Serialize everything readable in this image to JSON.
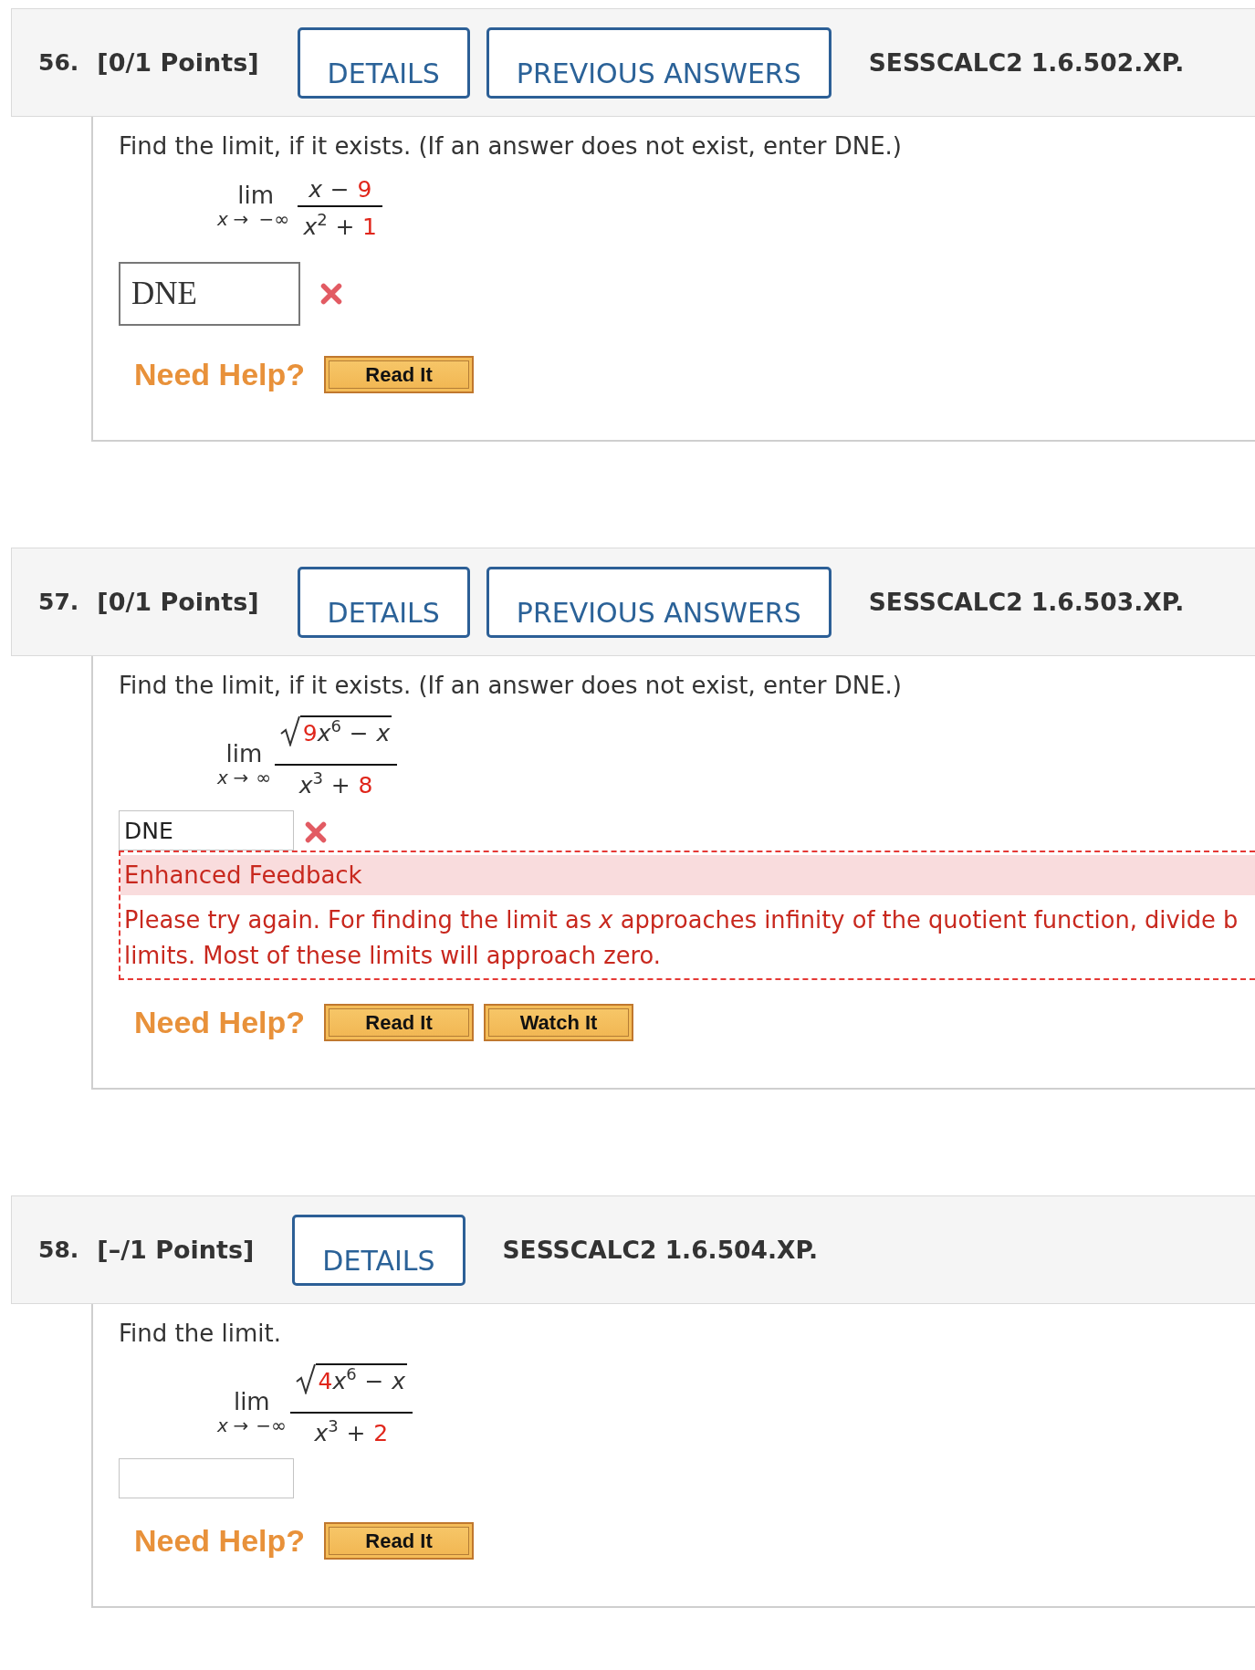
{
  "questions": [
    {
      "number": "56.",
      "points": "[0/1 Points]",
      "buttons": [
        "DETAILS",
        "PREVIOUS ANSWERS"
      ],
      "code": "SESSCALC2 1.6.502.XP.",
      "prompt": "Find the limit, if it exists. (If an answer does not exist, enter DNE.)",
      "limit": {
        "operator": "lim",
        "subscript": [
          {
            "kind": "var",
            "text": "x"
          },
          {
            "kind": "op",
            "text": "→"
          },
          {
            "kind": "op",
            "text": "−∞"
          }
        ],
        "numerator": {
          "radical": false,
          "terms": [
            {
              "kind": "var",
              "text": "x"
            },
            {
              "kind": "op",
              "text": "−"
            },
            {
              "kind": "const",
              "text": "9"
            }
          ]
        },
        "denominator": {
          "terms": [
            {
              "kind": "var",
              "text": "x"
            },
            {
              "kind": "sup",
              "text": "2"
            },
            {
              "kind": "op",
              "text": "+"
            },
            {
              "kind": "const",
              "text": "1"
            }
          ]
        }
      },
      "answer": {
        "kind": "large",
        "value": "DNE",
        "marked_wrong": true
      },
      "help_label": "Need Help?",
      "help_buttons": [
        "Read It"
      ]
    },
    {
      "number": "57.",
      "points": "[0/1 Points]",
      "buttons": [
        "DETAILS",
        "PREVIOUS ANSWERS"
      ],
      "code": "SESSCALC2 1.6.503.XP.",
      "prompt": "Find the limit, if it exists. (If an answer does not exist, enter DNE.)",
      "limit": {
        "operator": "lim",
        "subscript": [
          {
            "kind": "var",
            "text": "x"
          },
          {
            "kind": "op",
            "text": "→"
          },
          {
            "kind": "sym",
            "text": "∞"
          }
        ],
        "numerator": {
          "radical": true,
          "terms": [
            {
              "kind": "const",
              "text": "9"
            },
            {
              "kind": "var",
              "text": "x"
            },
            {
              "kind": "sup",
              "text": "6"
            },
            {
              "kind": "op",
              "text": "−"
            },
            {
              "kind": "var",
              "text": "x"
            }
          ]
        },
        "denominator": {
          "terms": [
            {
              "kind": "var",
              "text": "x"
            },
            {
              "kind": "sup",
              "text": "3"
            },
            {
              "kind": "op",
              "text": "+"
            },
            {
              "kind": "const",
              "text": "8"
            }
          ]
        }
      },
      "answer": {
        "kind": "compact",
        "value": "DNE",
        "marked_wrong": true
      },
      "feedback": {
        "heading": "Enhanced Feedback",
        "lines": [
          "Please try again. For finding the limit as *x* approaches infinity of the quotient function, divide b",
          "limits. Most of these limits will approach zero."
        ]
      },
      "help_label": "Need Help?",
      "help_buttons": [
        "Read It",
        "Watch It"
      ]
    },
    {
      "number": "58.",
      "points": "[–/1 Points]",
      "buttons": [
        "DETAILS"
      ],
      "code": "SESSCALC2 1.6.504.XP.",
      "prompt": "Find the limit.",
      "limit": {
        "operator": "lim",
        "subscript": [
          {
            "kind": "var",
            "text": "x"
          },
          {
            "kind": "op",
            "text": "→"
          },
          {
            "kind": "sym",
            "text": "−∞"
          }
        ],
        "numerator": {
          "radical": true,
          "terms": [
            {
              "kind": "const",
              "text": "4"
            },
            {
              "kind": "var",
              "text": "x"
            },
            {
              "kind": "sup",
              "text": "6"
            },
            {
              "kind": "op",
              "text": "−"
            },
            {
              "kind": "var",
              "text": "x"
            }
          ]
        },
        "denominator": {
          "terms": [
            {
              "kind": "var",
              "text": "x"
            },
            {
              "kind": "sup",
              "text": "3"
            },
            {
              "kind": "op",
              "text": "+"
            },
            {
              "kind": "const",
              "text": "2"
            }
          ]
        }
      },
      "answer": {
        "kind": "compact",
        "marked_wrong": false
      },
      "help_label": "Need Help?",
      "help_buttons": [
        "Read It"
      ]
    }
  ]
}
